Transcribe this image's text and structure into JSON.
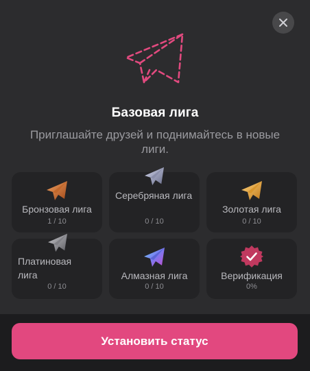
{
  "header": {
    "title": "Базовая лига",
    "subtitle": "Приглашайте друзей и поднимайтесь в новые лиги."
  },
  "leagues": [
    {
      "label": "Бронзовая лига",
      "count": "1 / 10",
      "icon": "bronze-plane-icon"
    },
    {
      "label": "Серебряная лига",
      "count": "0 / 10",
      "icon": "silver-plane-icon"
    },
    {
      "label": "Золотая лига",
      "count": "0 / 10",
      "icon": "gold-plane-icon"
    },
    {
      "label": "Платиновая лига",
      "count": "0 / 10",
      "icon": "platinum-plane-icon"
    },
    {
      "label": "Алмазная лига",
      "count": "0 / 10",
      "icon": "diamond-plane-icon"
    },
    {
      "label": "Верификация",
      "count": "0%",
      "icon": "verified-badge-icon"
    }
  ],
  "cta": {
    "label": "Установить статус"
  },
  "colors": {
    "accent": "#e2487f",
    "hero_dash": "#e24a7f",
    "background": "#2c2c2e",
    "card": "#232325"
  }
}
